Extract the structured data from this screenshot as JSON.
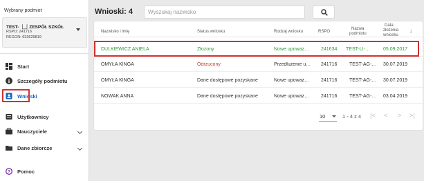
{
  "sidebar": {
    "caption": "Wybrany podmiot",
    "org": {
      "name": "TEST- ⎿⏌ZESPÓŁ SZKÓŁ",
      "rspo": "RSPO: 241716",
      "regon": "REGON: 633629819"
    },
    "items": [
      {
        "label": "Start",
        "icon": "dashboard-icon"
      },
      {
        "label": "Szczegóły podmiotu",
        "icon": "info-icon"
      },
      {
        "label": "Wnioski",
        "icon": "id-card-icon"
      },
      {
        "label": "Użytkownicy",
        "icon": "users-icon"
      },
      {
        "label": "Nauczyciele",
        "icon": "briefcase-icon"
      },
      {
        "label": "Dane zbiorcze",
        "icon": "folder-icon"
      },
      {
        "label": "Pomoc",
        "icon": "help-icon"
      }
    ]
  },
  "header": {
    "title": "Wnioski: 4",
    "search_placeholder": "Wyszukaj nazwisko"
  },
  "table": {
    "columns": {
      "name": "Nazwisko i imię",
      "status": "Status wniosku",
      "type": "Rodzaj wniosku",
      "rspo": "RSPO",
      "entity1": "Nazwa",
      "entity2": "podmiotu",
      "date1": "Data",
      "date2": "złożenia",
      "date3": "wniosku"
    },
    "rows": [
      {
        "name": "DULKIEWICZ ANIELA",
        "status": "Złożony",
        "type": "Nowe upoważ…",
        "rspo": "241634",
        "entity": "TEST-LI-…",
        "date": "05.09.2017"
      },
      {
        "name": "OMYŁA KINGA",
        "status": "Odrzucony",
        "type": "Przedłużenie u…",
        "rspo": "241716",
        "entity": "TEST-AG-…",
        "date": "30.07.2019"
      },
      {
        "name": "OMYŁA KINGA",
        "status": "Dane dostępowe pozyskane",
        "type": "Nowe upoważ…",
        "rspo": "241716",
        "entity": "TEST-AG-…",
        "date": "30.07.2019"
      },
      {
        "name": "NOWAK ANNA",
        "status": "Dane dostępowe pozyskane",
        "type": "Nowe upoważ…",
        "rspo": "241716",
        "entity": "TEST-AG-…",
        "date": "03.04.2019"
      }
    ]
  },
  "pagination": {
    "page_size": "10",
    "range": "1 - 4 z 4",
    "first": "|<",
    "prev": "<",
    "next": ">",
    "last": ">|"
  },
  "colors": {
    "accent": "#1565c0",
    "selected_text": "#2e9b3a",
    "rejected_text": "#c0392b",
    "highlight": "#d32f2f"
  }
}
